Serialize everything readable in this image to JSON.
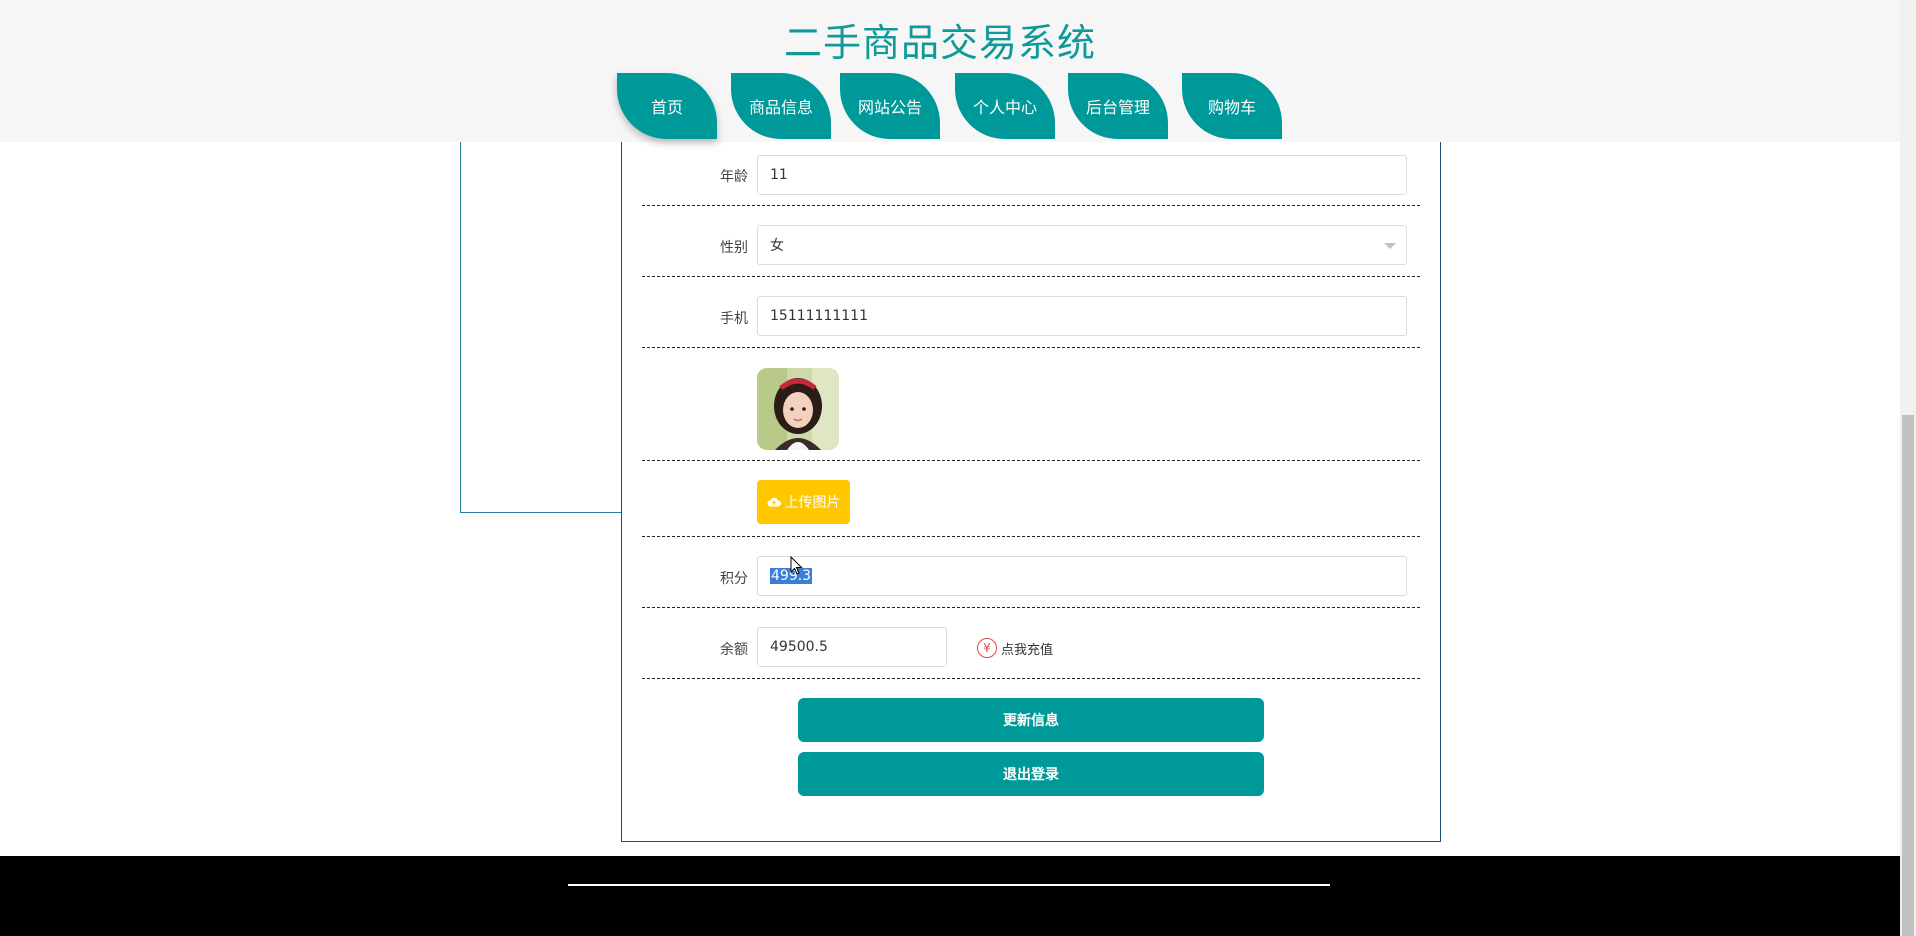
{
  "header": {
    "site_title": "二手商品交易系统",
    "nav": [
      "首页",
      "商品信息",
      "网站公告",
      "个人中心",
      "后台管理",
      "购物车"
    ]
  },
  "form": {
    "age": {
      "label": "年龄",
      "value": "11"
    },
    "gender": {
      "label": "性别",
      "value": "女"
    },
    "phone": {
      "label": "手机",
      "value": "15111111111"
    },
    "upload_label": "上传图片",
    "points": {
      "label": "积分",
      "value": "499.3"
    },
    "balance": {
      "label": "余额",
      "value": "49500.5",
      "recharge_label": "点我充值"
    },
    "update_button": "更新信息",
    "logout_button": "退出登录"
  },
  "colors": {
    "primary": "#00999a",
    "title": "#0f9a99",
    "upload": "#ffc700",
    "footer": "#000000"
  },
  "icons": {
    "upload": "cloud-upload-icon",
    "recharge": "yen-icon",
    "dropdown": "chevron-down-icon",
    "cursor": "mouse-cursor-icon"
  }
}
